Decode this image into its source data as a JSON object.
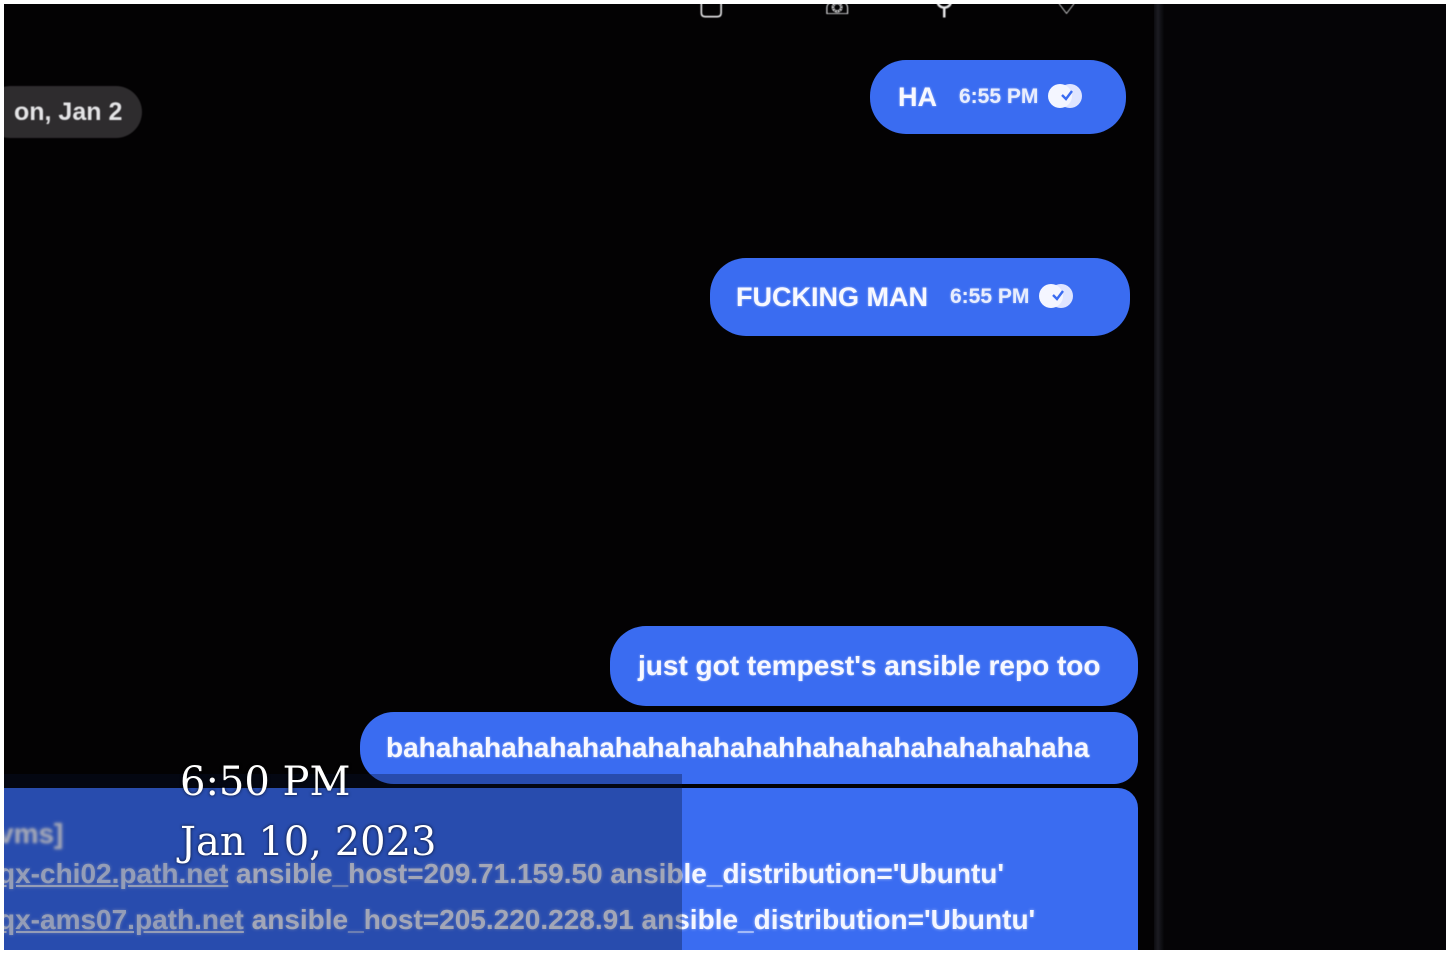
{
  "date_divider": "on, Jan 2",
  "messages": [
    {
      "text": "HA",
      "time": "6:55 PM"
    },
    {
      "text": "FUCKING MAN",
      "time": "6:55 PM"
    },
    {
      "text": "just got tempest's ansible repo too"
    },
    {
      "text": "bahahahahahahahahahahahahhahahahahahahahaha"
    }
  ],
  "code_block": {
    "line1": "vms]",
    "line2_host": "qx-chi02.path.net",
    "line2_rest": " ansible_host=209.71.159.50 ansible_distribution='Ubuntu'",
    "line3_host": "qx-ams07.path.net",
    "line3_rest": " ansible_host=205.220.228.91 ansible_distribution='Ubuntu'"
  },
  "overlay": {
    "time": "6:50 PM",
    "date": "Jan 10, 2023"
  },
  "icons": [
    "video-call-icon",
    "phone-icon",
    "search-icon",
    "more-icon",
    "read-receipt-icon"
  ],
  "colors": {
    "bubble": "#3a6cf1",
    "background": "#030203",
    "date_pill": "#2e2c2e"
  }
}
